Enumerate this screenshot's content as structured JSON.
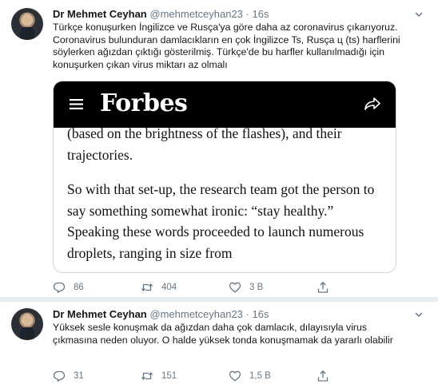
{
  "tweets": [
    {
      "author_name": "Dr Mehmet Ceyhan",
      "handle": "@mehmetceyhan23",
      "separator": "·",
      "time": "16s",
      "text": "Türkçe konuşurken İngilizce ve Rusça'ya göre daha az coronavirus çıkarıyoruz. Coronavirus bulunduran damlacıkların en çok İngilizce Ts, Rusça ц (ts) harflerini söylerken ağızdan çıktığı gösterilmiş. Türkçe'de bu harfler kullanılmadığı için konuşurken çıkan virus miktarı az olmalı",
      "media": {
        "brand": "Forbes",
        "paragraph1": "(based on the brightness of the flashes), and their trajectories.",
        "paragraph2": "So with that set-up, the research team got the person to say something somewhat ironic: “stay healthy.” Speaking these words proceeded to launch numerous droplets, ranging in size from"
      },
      "reply_count": "86",
      "retweet_count": "404",
      "like_count": "3 B"
    },
    {
      "author_name": "Dr Mehmet Ceyhan",
      "handle": "@mehmetceyhan23",
      "separator": "·",
      "time": "16s",
      "text": "Yüksek sesle konuşmak da ağızdan daha çok damlacık, dılayısıyla virus çıkmasına neden oluyor. O halde yüksek tonda konuşmamak da yararlı olabilir",
      "reply_count": "31",
      "retweet_count": "151",
      "like_count": "1,5 B"
    }
  ],
  "icons": {
    "reply": "reply-icon",
    "retweet": "retweet-icon",
    "like": "like-icon",
    "share": "share-icon",
    "caret": "chevron-down-icon",
    "menu": "hamburger-menu-icon",
    "media_share": "forward-share-icon"
  },
  "colors": {
    "text": "#14171a",
    "secondary": "#657786",
    "border": "#ccd6dd",
    "divider": "#e6ecf0",
    "forbes_bar": "#000000"
  }
}
